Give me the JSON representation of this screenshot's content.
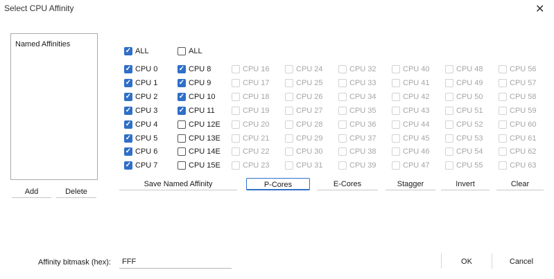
{
  "window": {
    "title": "Select CPU Affinity",
    "close_glyph": "✕"
  },
  "named_affinities": {
    "header": "Named Affinities",
    "add_label": "Add",
    "delete_label": "Delete"
  },
  "columns": [
    {
      "all_label": "ALL",
      "all_checked": true,
      "disabled": false,
      "cpus": [
        {
          "label": "CPU 0",
          "checked": true
        },
        {
          "label": "CPU 1",
          "checked": true
        },
        {
          "label": "CPU 2",
          "checked": true
        },
        {
          "label": "CPU 3",
          "checked": true
        },
        {
          "label": "CPU 4",
          "checked": true
        },
        {
          "label": "CPU 5",
          "checked": true
        },
        {
          "label": "CPU 6",
          "checked": true
        },
        {
          "label": "CPU 7",
          "checked": true
        }
      ]
    },
    {
      "all_label": "ALL",
      "all_checked": false,
      "disabled": false,
      "cpus": [
        {
          "label": "CPU 8",
          "checked": true
        },
        {
          "label": "CPU 9",
          "checked": true
        },
        {
          "label": "CPU 10",
          "checked": true
        },
        {
          "label": "CPU 11",
          "checked": true
        },
        {
          "label": "CPU 12E",
          "checked": false
        },
        {
          "label": "CPU 13E",
          "checked": false
        },
        {
          "label": "CPU 14E",
          "checked": false
        },
        {
          "label": "CPU 15E",
          "checked": false
        }
      ]
    },
    {
      "disabled": true,
      "cpus": [
        {
          "label": "CPU 16"
        },
        {
          "label": "CPU 17"
        },
        {
          "label": "CPU 18"
        },
        {
          "label": "CPU 19"
        },
        {
          "label": "CPU 20"
        },
        {
          "label": "CPU 21"
        },
        {
          "label": "CPU 22"
        },
        {
          "label": "CPU 23"
        }
      ]
    },
    {
      "disabled": true,
      "cpus": [
        {
          "label": "CPU 24"
        },
        {
          "label": "CPU 25"
        },
        {
          "label": "CPU 26"
        },
        {
          "label": "CPU 27"
        },
        {
          "label": "CPU 28"
        },
        {
          "label": "CPU 29"
        },
        {
          "label": "CPU 30"
        },
        {
          "label": "CPU 31"
        }
      ]
    },
    {
      "disabled": true,
      "cpus": [
        {
          "label": "CPU 32"
        },
        {
          "label": "CPU 33"
        },
        {
          "label": "CPU 34"
        },
        {
          "label": "CPU 35"
        },
        {
          "label": "CPU 36"
        },
        {
          "label": "CPU 37"
        },
        {
          "label": "CPU 38"
        },
        {
          "label": "CPU 39"
        }
      ]
    },
    {
      "disabled": true,
      "cpus": [
        {
          "label": "CPU 40"
        },
        {
          "label": "CPU 41"
        },
        {
          "label": "CPU 42"
        },
        {
          "label": "CPU 43"
        },
        {
          "label": "CPU 44"
        },
        {
          "label": "CPU 45"
        },
        {
          "label": "CPU 46"
        },
        {
          "label": "CPU 47"
        }
      ]
    },
    {
      "disabled": true,
      "cpus": [
        {
          "label": "CPU 48"
        },
        {
          "label": "CPU 49"
        },
        {
          "label": "CPU 50"
        },
        {
          "label": "CPU 51"
        },
        {
          "label": "CPU 52"
        },
        {
          "label": "CPU 53"
        },
        {
          "label": "CPU 54"
        },
        {
          "label": "CPU 55"
        }
      ]
    },
    {
      "disabled": true,
      "cpus": [
        {
          "label": "CPU 56"
        },
        {
          "label": "CPU 57"
        },
        {
          "label": "CPU 58"
        },
        {
          "label": "CPU 59"
        },
        {
          "label": "CPU 60"
        },
        {
          "label": "CPU 61"
        },
        {
          "label": "CPU 62"
        },
        {
          "label": "CPU 63"
        }
      ]
    }
  ],
  "actions": {
    "save_named": "Save Named Affinity",
    "p_cores": "P-Cores",
    "e_cores": "E-Cores",
    "stagger": "Stagger",
    "invert": "Invert",
    "clear": "Clear"
  },
  "bitmask": {
    "label": "Affinity bitmask (hex):",
    "value": "FFF"
  },
  "footer": {
    "ok_label": "OK",
    "cancel_label": "Cancel"
  },
  "colors": {
    "accent": "#2f6fc7",
    "disabled_text": "#a6a6a6"
  }
}
